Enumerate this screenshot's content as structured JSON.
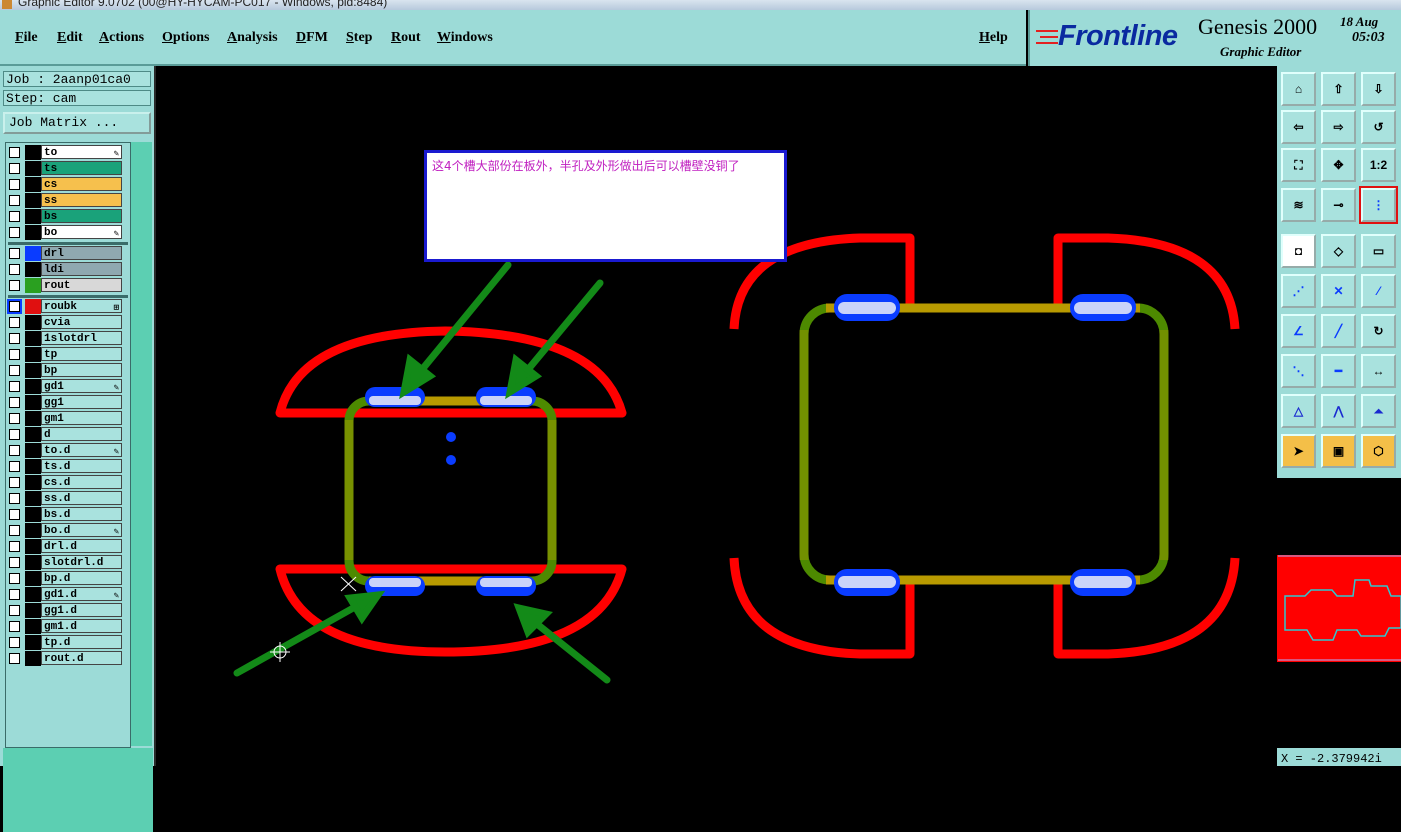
{
  "window": {
    "title": "Graphic Editor 9.0702 (00@HY-HYCAM-PC017 - Windows, pid:8484)"
  },
  "menu": [
    "File",
    "Edit",
    "Actions",
    "Options",
    "Analysis",
    "DFM",
    "Step",
    "Rout",
    "Windows"
  ],
  "help_label": "Help",
  "brand": {
    "logo": "Frontline",
    "product": "Genesis 2000",
    "subtitle": "Graphic Editor",
    "date": "18 Aug",
    "time": "05:03"
  },
  "job": {
    "job_line": "Job : 2aanp01ca0",
    "step_line": "Step: cam",
    "matrix_button": "Job Matrix ..."
  },
  "layers": {
    "group1": [
      {
        "name": "to",
        "color": "#ffffff",
        "swatch": "#000000",
        "marked": true
      },
      {
        "name": "ts",
        "color": "#1aa27a",
        "swatch": "#000000",
        "marked": false
      },
      {
        "name": "cs",
        "color": "#f6c04d",
        "swatch": "#000000",
        "marked": false
      },
      {
        "name": "ss",
        "color": "#f6c04d",
        "swatch": "#000000",
        "marked": false
      },
      {
        "name": "bs",
        "color": "#1aa27a",
        "swatch": "#000000",
        "marked": false
      },
      {
        "name": "bo",
        "color": "#ffffff",
        "swatch": "#000000",
        "marked": true
      }
    ],
    "group2": [
      {
        "name": "drl",
        "color": "#8fa8b0",
        "swatch": "#0a3cff",
        "marked": false
      },
      {
        "name": "ldi",
        "color": "#8fa8b0",
        "swatch": "#000000",
        "marked": false
      },
      {
        "name": "rout",
        "color": "#d8d8d8",
        "swatch": "#2aa020",
        "marked": false
      }
    ],
    "group3": [
      {
        "name": "roubk",
        "color": "#a9e2de",
        "swatch": "#e01010",
        "marked": true,
        "active": true
      },
      {
        "name": "cvia"
      },
      {
        "name": "1slotdrl"
      },
      {
        "name": "tp"
      },
      {
        "name": "bp"
      },
      {
        "name": "gd1",
        "marked": true
      },
      {
        "name": "gg1"
      },
      {
        "name": "gm1"
      },
      {
        "name": "d"
      },
      {
        "name": "to.d",
        "marked": true
      },
      {
        "name": "ts.d"
      },
      {
        "name": "cs.d"
      },
      {
        "name": "ss.d"
      },
      {
        "name": "bs.d"
      },
      {
        "name": "bo.d",
        "marked": true
      },
      {
        "name": "drl.d"
      },
      {
        "name": "slotdrl.d"
      },
      {
        "name": "bp.d"
      },
      {
        "name": "gd1.d",
        "marked": true
      },
      {
        "name": "gg1.d"
      },
      {
        "name": "gm1.d"
      },
      {
        "name": "tp.d"
      },
      {
        "name": "rout.d"
      }
    ]
  },
  "note": {
    "text": "这4个槽大部份在板外，半孔及外形做出后可以槽壁没铜了"
  },
  "toolbar": {
    "scale_label": "1:2",
    "icons": [
      "home-icon",
      "page-up-icon",
      "page-down-icon",
      "page-left-icon",
      "page-right-icon",
      "undo-zoom-icon",
      "zoom-fit-icon",
      "zoom-center-icon",
      "zoom-scale-icon",
      "snap-icon",
      "measure-icon",
      "net-icon",
      "frame-icon",
      "shape-icon",
      "ruler-icon",
      "connect-icon",
      "cross-icon",
      "point-icon",
      "angle-icon",
      "line-icon",
      "arc-icon",
      "point-distance-icon",
      "minus-icon",
      "dimension-icon",
      "triangle-add-icon",
      "triangle-up-icon",
      "triangle-frame-icon",
      "select-icon",
      "select-frame-icon",
      "select-polygon-icon"
    ]
  },
  "colors": {
    "menu_bg": "#9cdbd7",
    "outline": "#ff0000",
    "rout_path": "#4d8a00",
    "slot": "#0a3cff",
    "arrow": "#138a18"
  },
  "coordinate": "X = -2.379942i"
}
